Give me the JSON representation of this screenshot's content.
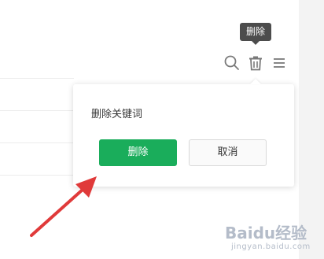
{
  "tooltip": {
    "text": "删除"
  },
  "toolbar": {
    "icons": [
      "search-icon",
      "trash-icon",
      "menu-icon"
    ]
  },
  "popover": {
    "title": "删除关键词",
    "confirm_label": "删除",
    "cancel_label": "取消"
  },
  "colors": {
    "primary": "#1aad5b",
    "annotation_arrow": "#e03a3a",
    "tooltip_bg": "#4c4c4c"
  },
  "watermark": {
    "logo": "Baidu经验",
    "site": "jingyan.baidu.com"
  }
}
